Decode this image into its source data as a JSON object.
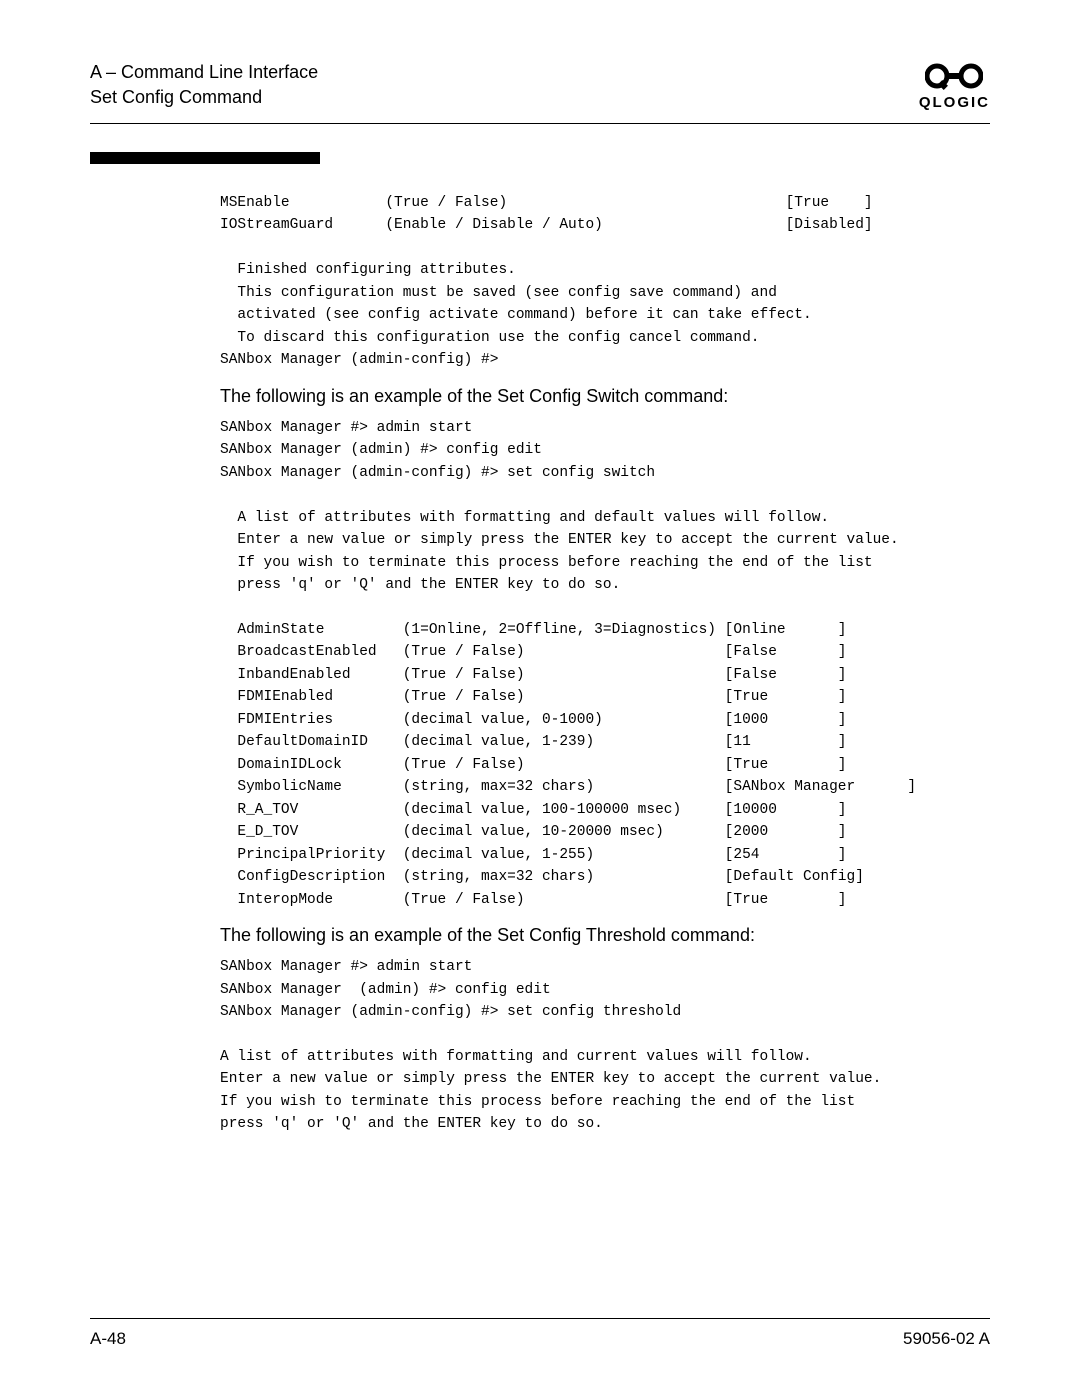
{
  "header": {
    "line1": "A – Command Line Interface",
    "line2": "Set Config Command",
    "logo_text": "QLOGIC"
  },
  "block1": "MSEnable           (True / False)                                [True    ]\nIOStreamGuard      (Enable / Disable / Auto)                     [Disabled]\n\n  Finished configuring attributes.\n  This configuration must be saved (see config save command) and\n  activated (see config activate command) before it can take effect.\n  To discard this configuration use the config cancel command.\nSANbox Manager (admin-config) #>",
  "heading2": "The following is an example of the Set Config Switch command:",
  "block2": "SANbox Manager #> admin start\nSANbox Manager (admin) #> config edit\nSANbox Manager (admin-config) #> set config switch\n\n  A list of attributes with formatting and default values will follow.\n  Enter a new value or simply press the ENTER key to accept the current value.\n  If you wish to terminate this process before reaching the end of the list\n  press 'q' or 'Q' and the ENTER key to do so.\n\n  AdminState         (1=Online, 2=Offline, 3=Diagnostics) [Online      ]\n  BroadcastEnabled   (True / False)                       [False       ]\n  InbandEnabled      (True / False)                       [False       ]\n  FDMIEnabled        (True / False)                       [True        ]\n  FDMIEntries        (decimal value, 0-1000)              [1000        ]\n  DefaultDomainID    (decimal value, 1-239)               [11          ]\n  DomainIDLock       (True / False)                       [True        ]\n  SymbolicName       (string, max=32 chars)               [SANbox Manager      ]\n  R_A_TOV            (decimal value, 100-100000 msec)     [10000       ]\n  E_D_TOV            (decimal value, 10-20000 msec)       [2000        ]\n  PrincipalPriority  (decimal value, 1-255)               [254         ]\n  ConfigDescription  (string, max=32 chars)               [Default Config]\n  InteropMode        (True / False)                       [True        ]",
  "heading3": "The following is an example of the Set Config Threshold command:",
  "block3": "SANbox Manager #> admin start\nSANbox Manager  (admin) #> config edit\nSANbox Manager (admin-config) #> set config threshold\n\nA list of attributes with formatting and current values will follow.\nEnter a new value or simply press the ENTER key to accept the current value.\nIf you wish to terminate this process before reaching the end of the list\npress 'q' or 'Q' and the ENTER key to do so.",
  "footer": {
    "left": "A-48",
    "right": "59056-02 A"
  }
}
